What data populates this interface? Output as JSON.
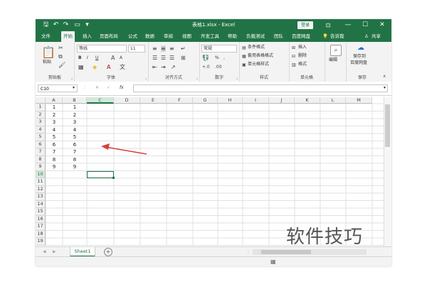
{
  "window": {
    "title": "表格1.xlsx - Excel",
    "login_button": "登录",
    "controls": {
      "minimize": "—",
      "maximize": "☐",
      "close": "✕"
    }
  },
  "tabs": [
    "文件",
    "开始",
    "插入",
    "页面布局",
    "公式",
    "数据",
    "审阅",
    "视图",
    "开发工具",
    "帮助",
    "负载测试",
    "团队",
    "百度网盘"
  ],
  "tell_me": "告诉我",
  "share": "共享",
  "ribbon": {
    "paste_label": "粘贴",
    "font_name": "等线",
    "font_size": "11",
    "bold": "B",
    "italic": "I",
    "underline": "U",
    "number_format": "常规",
    "percent": "%",
    "comma": ",",
    "cond_format": "条件格式",
    "table_format": "套用表格格式",
    "cell_style": "单元格样式",
    "insert": "插入",
    "delete": "删除",
    "format": "格式",
    "edit": "编辑",
    "save_to": "保存到",
    "baidu": "百度网盘",
    "groups": {
      "clipboard": "剪贴板",
      "font": "字体",
      "align": "对齐方式",
      "number": "数字",
      "styles": "样式",
      "cells": "单元格",
      "save": "保存"
    }
  },
  "formula_bar": {
    "name_box": "C10",
    "cancel": "✕",
    "enter": "✓",
    "fx": "fx",
    "value": ""
  },
  "grid": {
    "columns": [
      "A",
      "B",
      "C",
      "D",
      "E",
      "F",
      "G",
      "H",
      "I",
      "J",
      "K",
      "L",
      "M"
    ],
    "rows": [
      "1",
      "2",
      "3",
      "4",
      "5",
      "6",
      "7",
      "8",
      "9",
      "10",
      "11",
      "12",
      "13",
      "14",
      "15",
      "16",
      "17",
      "18",
      "19"
    ],
    "col_A": [
      "1",
      "2",
      "3",
      "4",
      "5",
      "6",
      "7",
      "8",
      "9"
    ],
    "col_B": [
      "1",
      "2",
      "3",
      "4",
      "5",
      "6",
      "7",
      "8",
      "9"
    ],
    "selected_cell": "C10",
    "arrow_color": "#d9413a"
  },
  "sheet_tab": "Sheet1",
  "add_sheet": "+",
  "watermark": "软件技巧",
  "colors": {
    "excel_green": "#217346"
  }
}
